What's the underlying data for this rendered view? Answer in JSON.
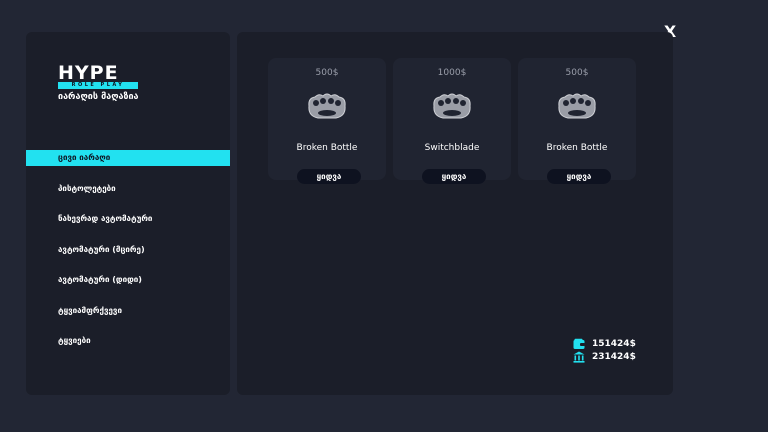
{
  "close_label": "X",
  "logo": {
    "main": "HYPE",
    "sub": "ROLE PLAY"
  },
  "store_name": "იარაღის მაღაზია",
  "nav": [
    {
      "label": "ცივი იარაღი",
      "active": true
    },
    {
      "label": "პისტოლეტები",
      "active": false
    },
    {
      "label": "ნახევრად ავტომატური",
      "active": false
    },
    {
      "label": "ავტომატური (მცირე)",
      "active": false
    },
    {
      "label": "ავტომატური (დიდი)",
      "active": false
    },
    {
      "label": "ტყვიამფრქვევი",
      "active": false
    },
    {
      "label": "ტყვიები",
      "active": false
    }
  ],
  "items": [
    {
      "price": "500$",
      "name": "Broken Bottle",
      "icon": "brass-knuckles-icon",
      "buy_label": "ყიდვა"
    },
    {
      "price": "1000$",
      "name": "Switchblade",
      "icon": "brass-knuckles-icon",
      "buy_label": "ყიდვა"
    },
    {
      "price": "500$",
      "name": "Broken Bottle",
      "icon": "brass-knuckles-icon",
      "buy_label": "ყიდვა"
    }
  ],
  "balance": {
    "wallet": {
      "icon": "wallet-icon",
      "amount": "151424$"
    },
    "bank": {
      "icon": "bank-icon",
      "amount": "231424$"
    }
  },
  "colors": {
    "accent": "#22e1f0",
    "panel": "#1b1e29",
    "card": "#202431",
    "background": "#222634"
  }
}
